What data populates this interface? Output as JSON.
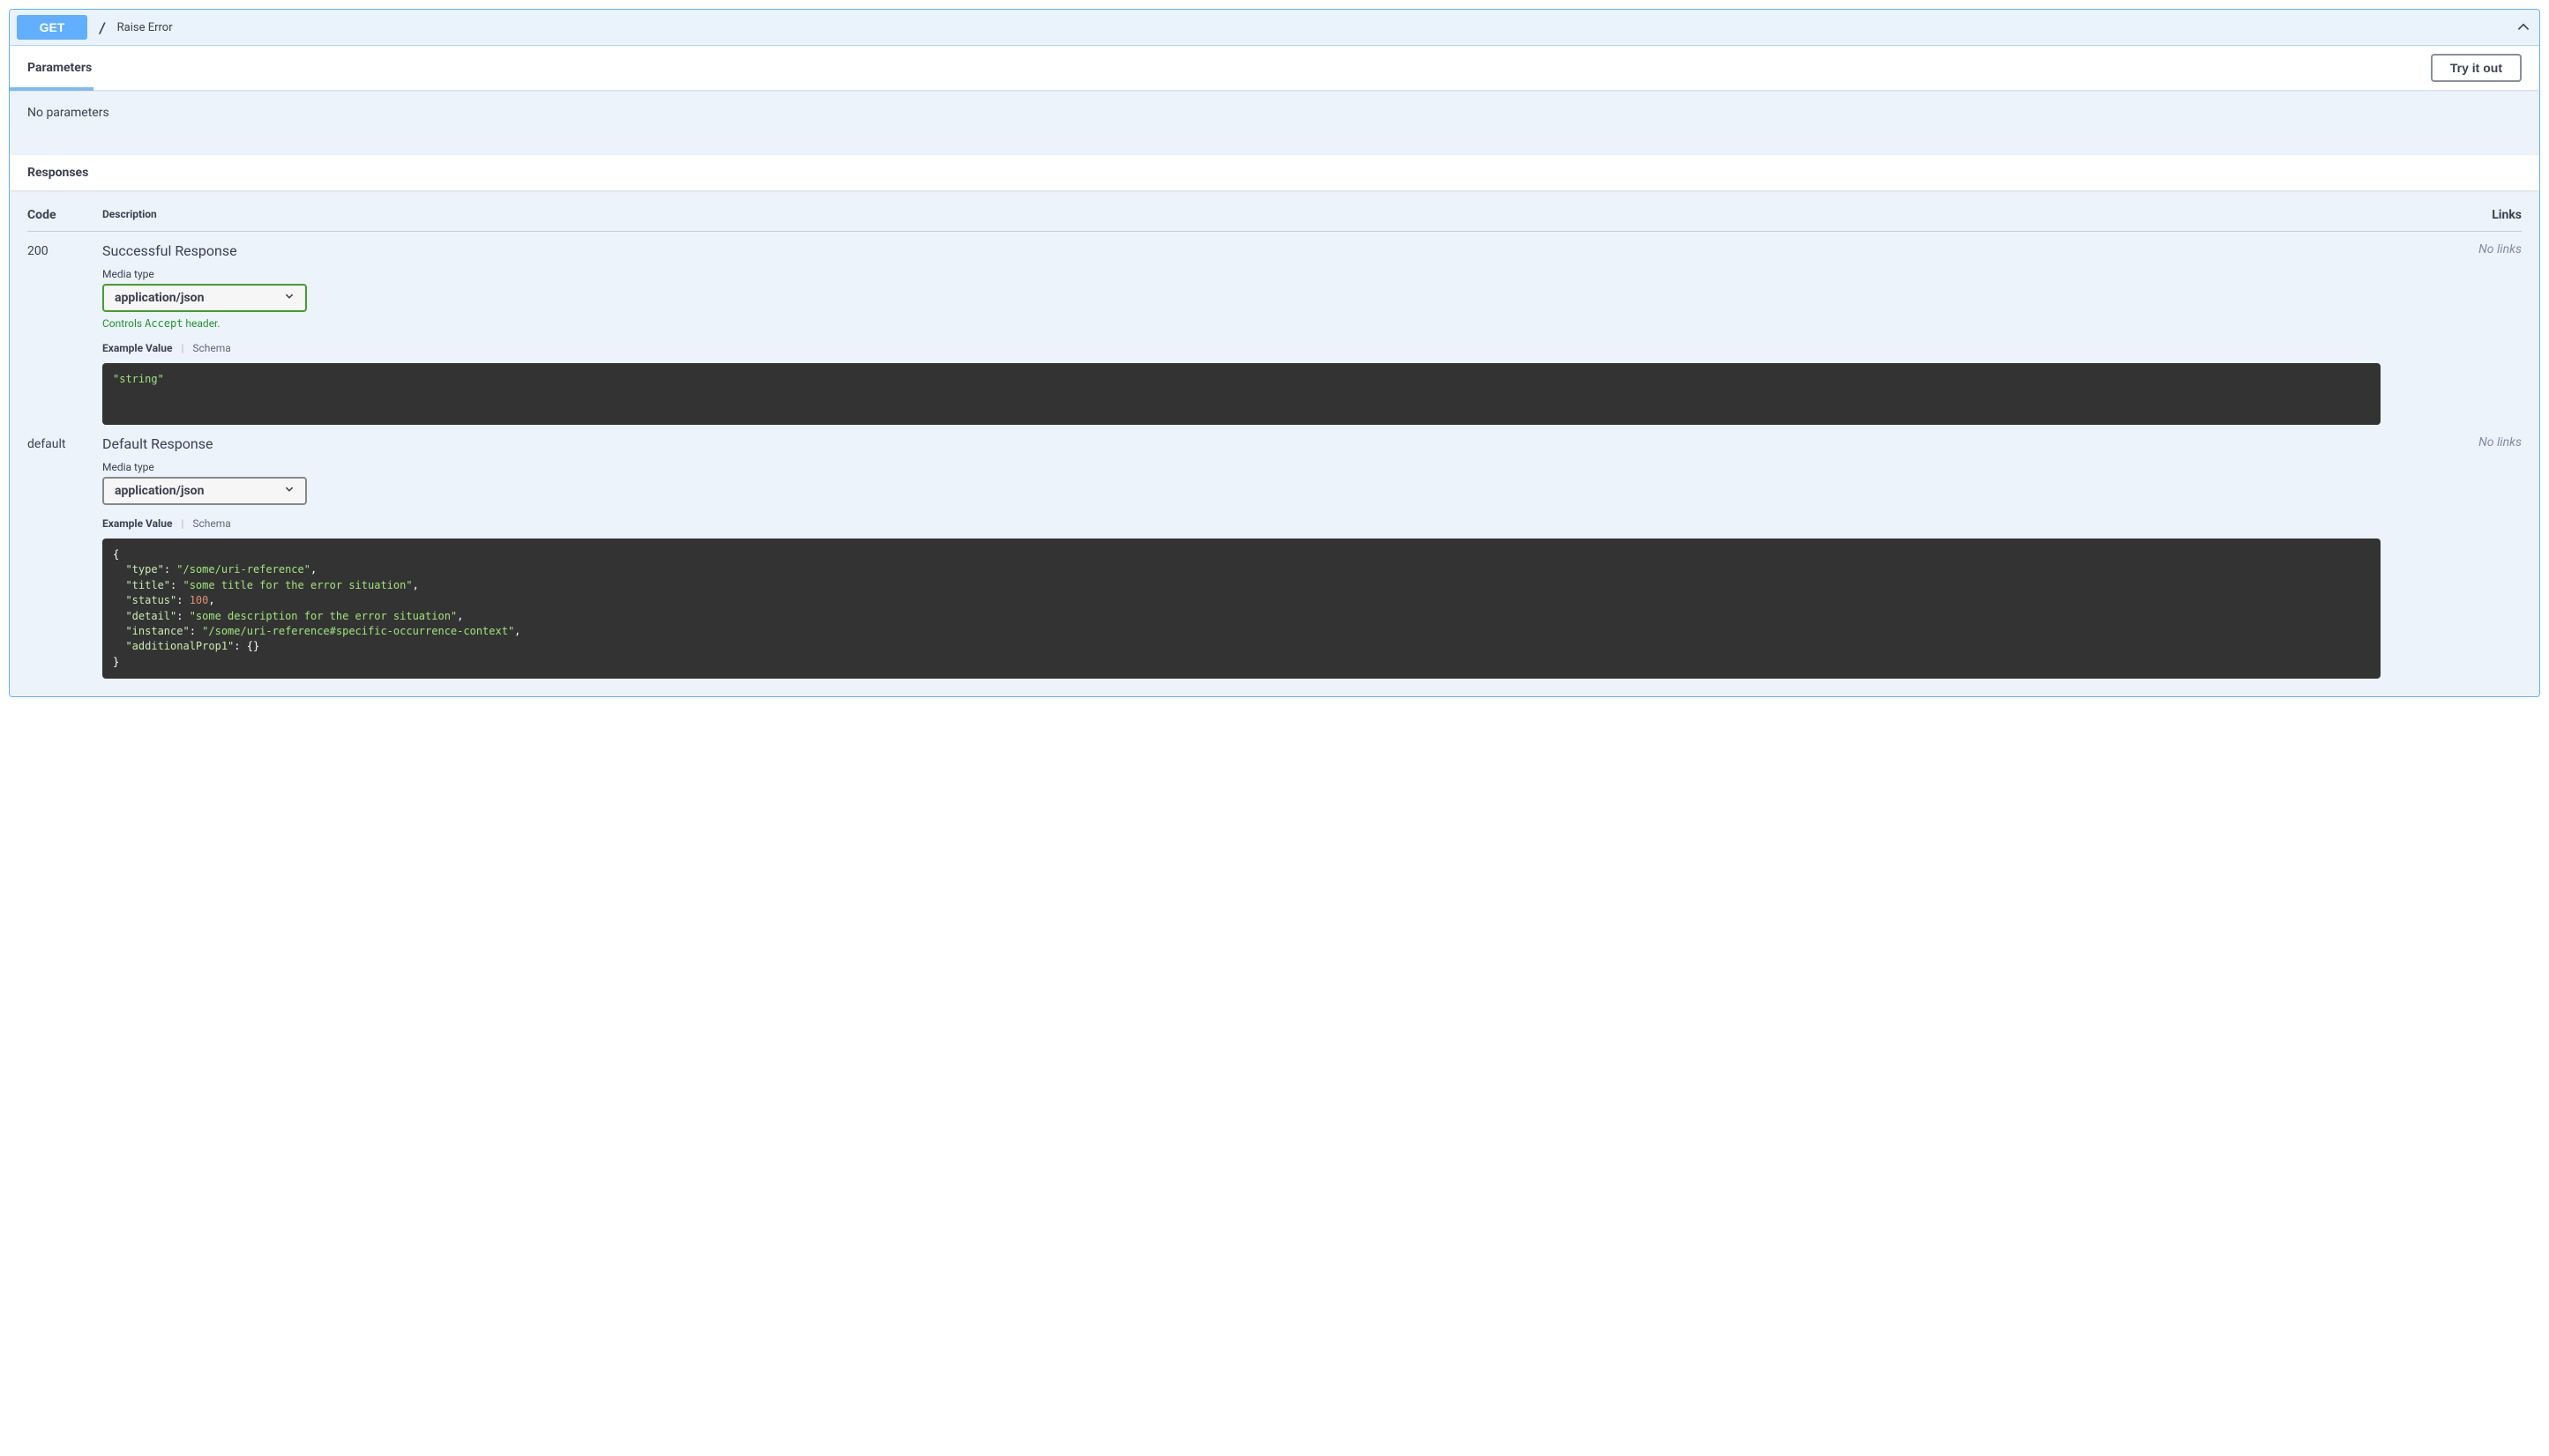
{
  "operation": {
    "method": "GET",
    "path": "/",
    "summary": "Raise Error"
  },
  "sections": {
    "parameters_title": "Parameters",
    "try_it_out": "Try it out",
    "no_parameters": "No parameters",
    "responses_title": "Responses"
  },
  "table_headers": {
    "code": "Code",
    "description": "Description",
    "links": "Links"
  },
  "media_type_label": "Media type",
  "accept_note_pre": "Controls ",
  "accept_note_code": "Accept",
  "accept_note_post": " header.",
  "tabs": {
    "example": "Example Value",
    "schema": "Schema"
  },
  "no_links": "No links",
  "responses": [
    {
      "code": "200",
      "description": "Successful Response",
      "media_type": "application/json",
      "show_accept_note": true,
      "select_style": "green"
    },
    {
      "code": "default",
      "description": "Default Response",
      "media_type": "application/json",
      "show_accept_note": false,
      "select_style": "gray"
    }
  ],
  "examples": {
    "200": {
      "value": "string"
    },
    "default": {
      "type": "/some/uri-reference",
      "title": "some title for the error situation",
      "status": 100,
      "detail": "some description for the error situation",
      "instance": "/some/uri-reference#specific-occurrence-context",
      "additionalProp1": {}
    }
  }
}
